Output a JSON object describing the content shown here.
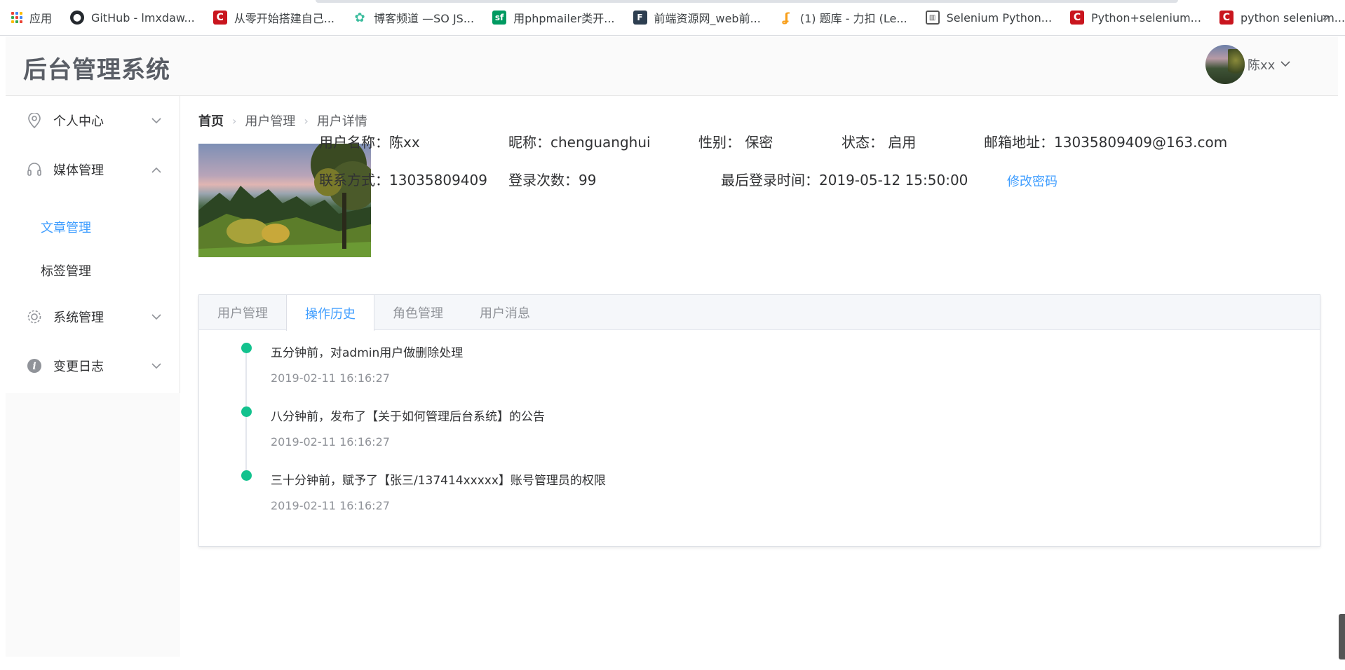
{
  "bookmarks": [
    {
      "label": "应用",
      "icon": "apps-grid-icon",
      "color": "#ea4335"
    },
    {
      "label": "GitHub - lmxdaw...",
      "icon": "github-icon",
      "color": "#24292e"
    },
    {
      "label": "从零开始搭建自己...",
      "icon": "csdn-icon",
      "color": "#c9151e"
    },
    {
      "label": "博客频道 —SO JS...",
      "icon": "gear-icon",
      "color": "#3dbd9e"
    },
    {
      "label": "用phpmailer类开...",
      "icon": "sf-icon",
      "color": "#009a61"
    },
    {
      "label": "前端资源网_web前...",
      "icon": "fe-icon",
      "color": "#2d3e50"
    },
    {
      "label": "(1) 题库 - 力扣 (Le...",
      "icon": "leetcode-icon",
      "color": "#f89f1b"
    },
    {
      "label": "Selenium Python...",
      "icon": "book-icon",
      "color": "#555555"
    },
    {
      "label": "Python+selenium...",
      "icon": "csdn-icon",
      "color": "#c9151e"
    },
    {
      "label": "python selenium...",
      "icon": "csdn-icon",
      "color": "#c9151e"
    }
  ],
  "bookmarks_more": "»",
  "header": {
    "title": "后台管理系统",
    "username": "陈xx"
  },
  "sidebar": {
    "items": [
      {
        "label": "个人中心",
        "icon": "location-icon",
        "expanded": false
      },
      {
        "label": "媒体管理",
        "icon": "headset-icon",
        "expanded": true,
        "children": [
          {
            "label": "文章管理",
            "active": true
          },
          {
            "label": "标签管理",
            "active": false
          }
        ]
      },
      {
        "label": "系统管理",
        "icon": "gear-icon",
        "expanded": false
      },
      {
        "label": "变更日志",
        "icon": "info-icon",
        "expanded": false
      }
    ]
  },
  "breadcrumb": [
    "首页",
    "用户管理",
    "用户详情"
  ],
  "profile": {
    "username": "用户名称：陈xx",
    "nickname": "昵称：chenguanghui",
    "gender": "性别： 保密",
    "status": "状态： 启用",
    "email": "邮箱地址：13035809409@163.com",
    "phone": "联系方式：13035809409",
    "login_count": "登录次数：99",
    "last_login": "最后登录时间：2019-05-12 15:50:00",
    "change_password": "修改密码"
  },
  "tabs": [
    {
      "label": "用户管理",
      "active": false
    },
    {
      "label": "操作历史",
      "active": true
    },
    {
      "label": "角色管理",
      "active": false
    },
    {
      "label": "用户消息",
      "active": false
    }
  ],
  "timeline": [
    {
      "content": "五分钟前，对admin用户做删除处理",
      "time": "2019-02-11 16:16:27"
    },
    {
      "content": "八分钟前，发布了【关于如何管理后台系统】的公告",
      "time": "2019-02-11 16:16:27"
    },
    {
      "content": "三十分钟前，赋予了【张三/137414xxxxx】账号管理员的权限",
      "time": "2019-02-11 16:16:27"
    }
  ],
  "colors": {
    "accent": "#409eff",
    "timeline_dot": "#13c28e"
  }
}
